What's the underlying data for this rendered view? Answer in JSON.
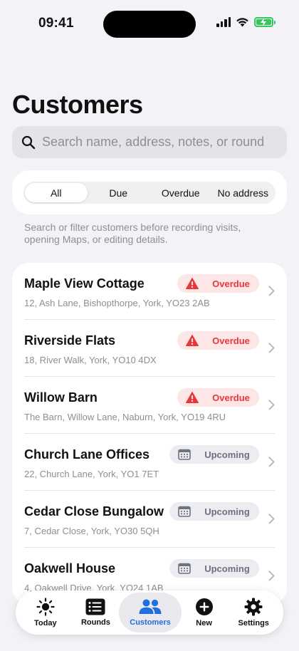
{
  "status_bar": {
    "time": "09:41"
  },
  "header": {
    "title": "Customers"
  },
  "search": {
    "placeholder": "Search name, address, notes, or round"
  },
  "filters": {
    "segments": [
      "All",
      "Due",
      "Overdue",
      "No address"
    ],
    "selected": "All"
  },
  "helper_text": "Search or filter customers before recording visits, opening Maps, or editing details.",
  "customers": [
    {
      "name": "Maple View Cottage",
      "address": "12, Ash Lane, Bishopthorpe, York, YO23 2AB",
      "status": "Overdue"
    },
    {
      "name": "Riverside Flats",
      "address": "18, River Walk, York, YO10 4DX",
      "status": "Overdue"
    },
    {
      "name": "Willow Barn",
      "address": "The Barn, Willow Lane, Naburn, York, YO19 4RU",
      "status": "Overdue"
    },
    {
      "name": "Church Lane Offices",
      "address": "22, Church Lane, York, YO1 7ET",
      "status": "Upcoming"
    },
    {
      "name": "Cedar Close Bungalow",
      "address": "7, Cedar Close, York, YO30 5QH",
      "status": "Upcoming"
    },
    {
      "name": "Oakwell House",
      "address": "4, Oakwell Drive, York, YO24 1AB",
      "status": "Upcoming"
    }
  ],
  "tabbar": {
    "items": [
      {
        "label": "Today",
        "icon": "sun-icon"
      },
      {
        "label": "Rounds",
        "icon": "list-icon"
      },
      {
        "label": "Customers",
        "icon": "people-icon",
        "active": true
      },
      {
        "label": "New",
        "icon": "plus-circle-icon"
      },
      {
        "label": "Settings",
        "icon": "gear-icon"
      }
    ]
  },
  "colors": {
    "accent": "#1f6fe0",
    "overdue": "#e5383b",
    "overdue_bg": "#fde6e6",
    "upcoming": "#6b7280",
    "background": "#f2f2f7"
  }
}
